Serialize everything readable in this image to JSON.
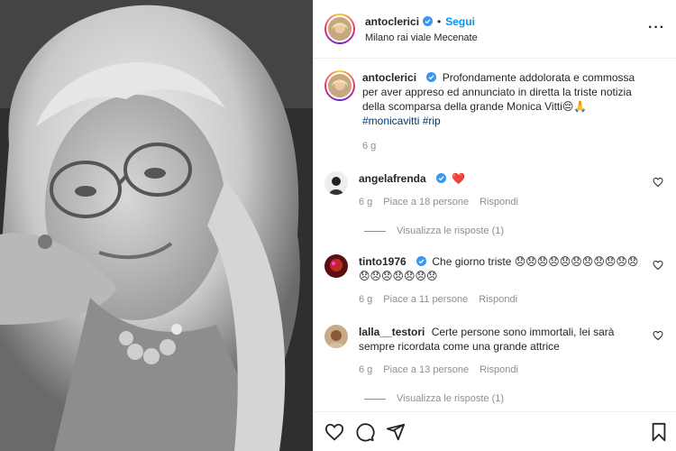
{
  "post": {
    "username": "antoclerici",
    "follow_label": "Segui",
    "separator": "•",
    "location": "Milano rai viale Mecenate",
    "more": "···"
  },
  "caption": {
    "username": "antoclerici",
    "text": "Profondamente addolorata e commossa per aver appreso ed annunciato in diretta la triste notizia della scomparsa della grande Monica Vitti😔🙏 ",
    "hashtags": [
      "#monicavitti",
      "#rip"
    ],
    "time": "6 g"
  },
  "comments": [
    {
      "username": "angelafrenda",
      "text": "❤️",
      "time": "6 g",
      "likes": "Piace a 18 persone",
      "reply": "Rispondi",
      "replies": "Visualizza le risposte (1)"
    },
    {
      "username": "tinto1976",
      "text": "Che giorno triste 😞😞😞😞😞😞😞😞😞😞😞😞😞😞😞😞😞😞",
      "time": "6 g",
      "likes": "Piace a 11 persone",
      "reply": "Rispondi"
    },
    {
      "username": "lalla__testori",
      "text": "Certe persone sono immortali, lei sarà sempre ricordata come una grande attrice",
      "time": "6 g",
      "likes": "Piace a 13 persone",
      "reply": "Rispondi",
      "replies": "Visualizza le risposte (1)"
    }
  ],
  "actions": [
    "heart-icon",
    "comment-icon",
    "share-icon",
    "bookmark-icon"
  ],
  "colors": {
    "verified": "#3897f0",
    "follow": "#0095f6",
    "hashtag": "#00376b",
    "meta": "#8e8e8e"
  }
}
